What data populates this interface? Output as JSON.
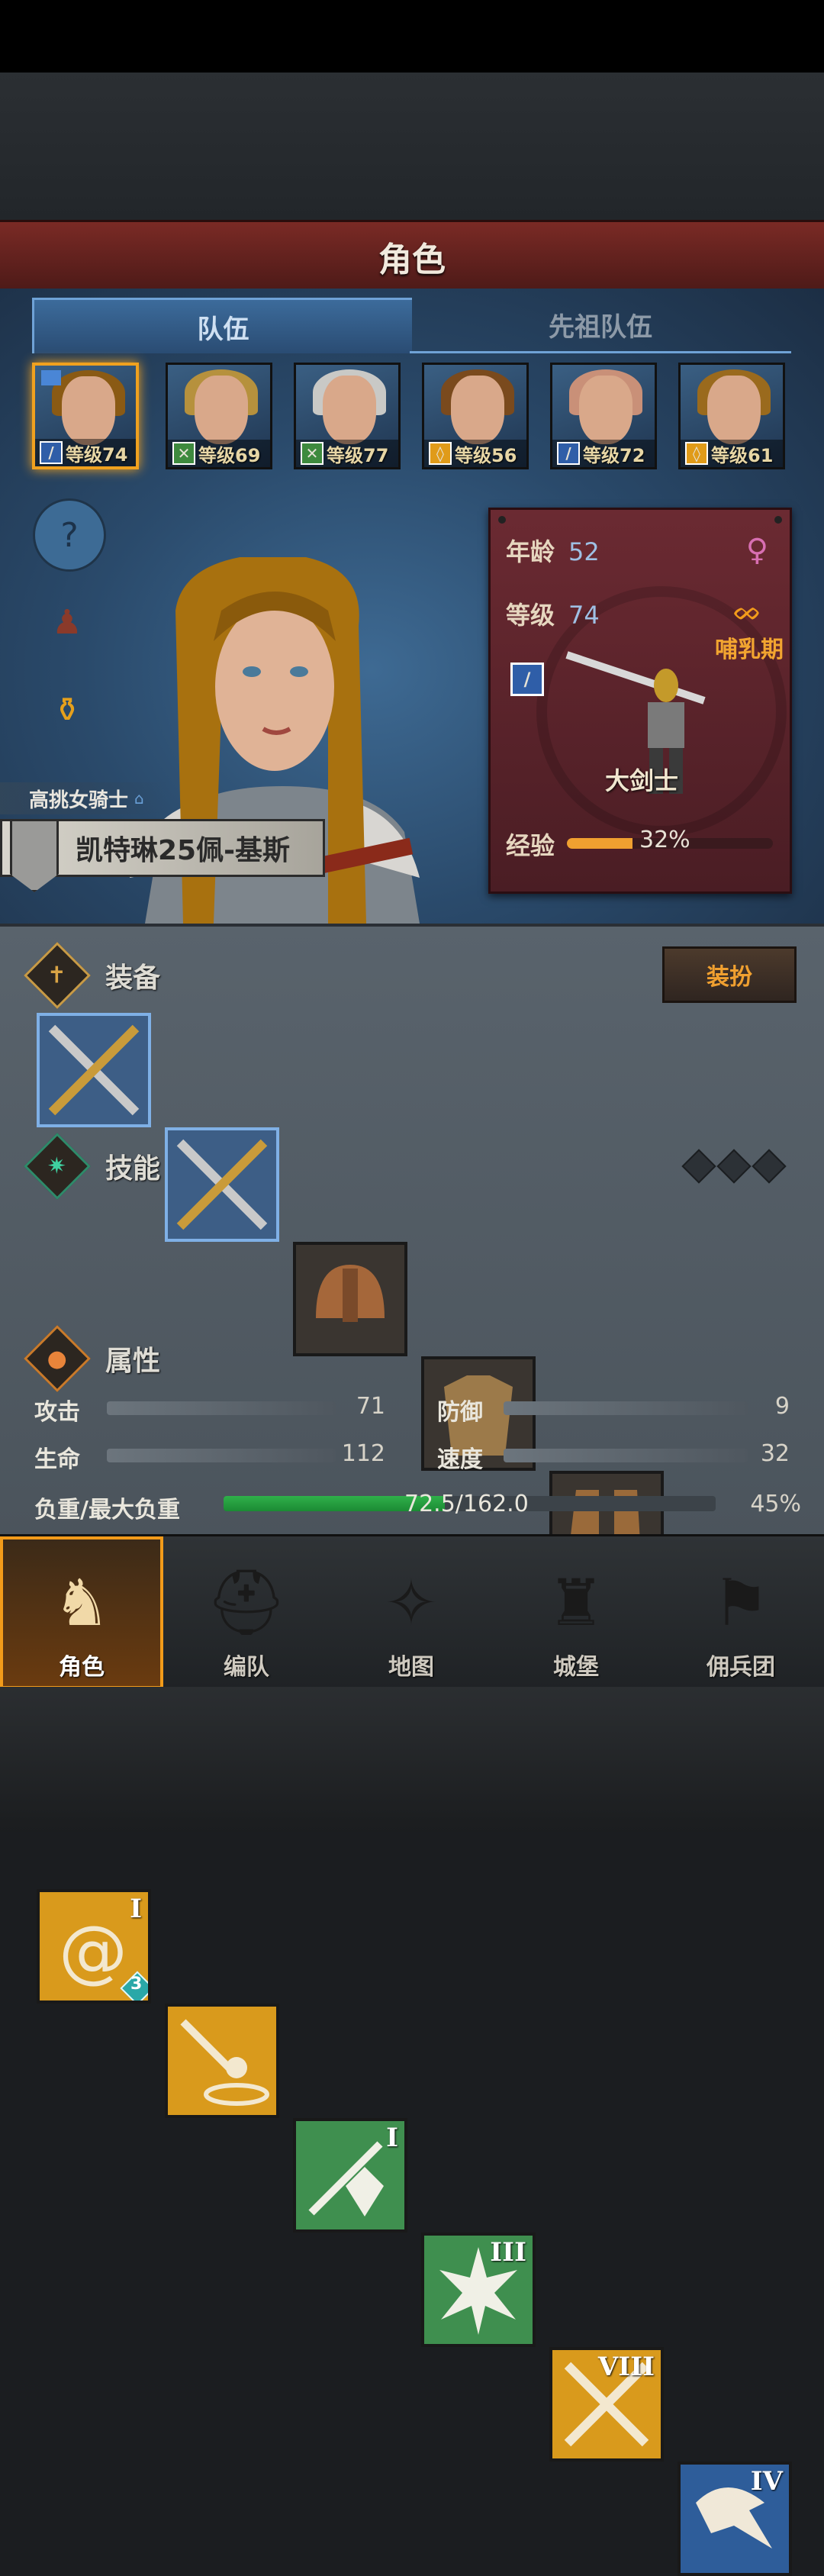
{
  "header": {
    "title": "角色"
  },
  "tabs": [
    {
      "label": "队伍",
      "active": true
    },
    {
      "label": "先祖队伍",
      "active": false
    }
  ],
  "roster": [
    {
      "level": "等级74",
      "class_icon": "sword-icon",
      "class_color": "#2f5ea8",
      "hair": "#8a5a14",
      "selected": true,
      "flag": true
    },
    {
      "level": "等级69",
      "class_icon": "bow-icon",
      "class_color": "#3e8a3e",
      "hair": "#b6913d"
    },
    {
      "level": "等级77",
      "class_icon": "bow-icon",
      "class_color": "#3e8a3e",
      "hair": "#c9c9c6"
    },
    {
      "level": "等级56",
      "class_icon": "shield-icon",
      "class_color": "#e09b19",
      "hair": "#7a4a1d"
    },
    {
      "level": "等级72",
      "class_icon": "sword-icon",
      "class_color": "#2f5ea8",
      "hair": "#c99078"
    },
    {
      "level": "等级61",
      "class_icon": "shield-icon",
      "class_color": "#e09b19",
      "hair": "#9a6a1d"
    }
  ],
  "side_buttons": [
    {
      "icon": "question-icon"
    },
    {
      "icon": "cloak-icon"
    },
    {
      "icon": "potion-icon"
    }
  ],
  "hero": {
    "title": "高挑女骑士",
    "name": "凯特琳25佩-基斯"
  },
  "info": {
    "age_label": "年龄",
    "age": "52",
    "level_label": "等级",
    "level": "74",
    "gender_icon": "female-icon",
    "status": "哺乳期",
    "status_icon": "ring-icon",
    "class_name": "大剑士",
    "exp_label": "经验",
    "exp_percent": "32%",
    "exp_fraction": 0.32
  },
  "equipment": {
    "title": "装备",
    "dress_button": "装扮",
    "slots": [
      {
        "icon": "greatsword-icon",
        "style": "blue"
      },
      {
        "icon": "greatsword-icon",
        "style": "blue"
      },
      {
        "icon": "helmet-icon",
        "style": "dark"
      },
      {
        "icon": "armor-icon",
        "style": "dark"
      },
      {
        "icon": "boots-icon",
        "style": "dark"
      },
      {
        "icon": "ring-slot-icon",
        "style": "empty"
      }
    ]
  },
  "skills": {
    "title": "技能",
    "items": [
      {
        "icon": "whirlwind-icon",
        "rank": "I",
        "color": "#d99a1c",
        "badge": "3"
      },
      {
        "icon": "sword-shield-icon",
        "rank": "",
        "color": "#d99a1c"
      },
      {
        "icon": "sword-crystal-icon",
        "rank": "I",
        "color": "#3f8f4f"
      },
      {
        "icon": "burst-icon",
        "rank": "III",
        "color": "#3f8f4f"
      },
      {
        "icon": "crossed-swords-icon",
        "rank": "VIII",
        "color": "#d99a1c"
      },
      {
        "icon": "eagle-icon",
        "rank": "IV",
        "color": "#2e5d9a"
      }
    ]
  },
  "attributes": {
    "title": "属性",
    "attack_label": "攻击",
    "attack": "71",
    "defense_label": "防御",
    "defense": "9",
    "hp_label": "生命",
    "hp": "112",
    "speed_label": "速度",
    "speed": "32",
    "load_label": "负重/最大负重",
    "load": "72.5/162.0",
    "load_percent": "45%",
    "load_fraction": 0.45
  },
  "nav": [
    {
      "label": "角色",
      "icon": "knight-icon",
      "active": true
    },
    {
      "label": "编队",
      "icon": "helmet-icon"
    },
    {
      "label": "地图",
      "icon": "compass-icon"
    },
    {
      "label": "城堡",
      "icon": "castle-icon"
    },
    {
      "label": "佣兵团",
      "icon": "banner-icon"
    }
  ]
}
